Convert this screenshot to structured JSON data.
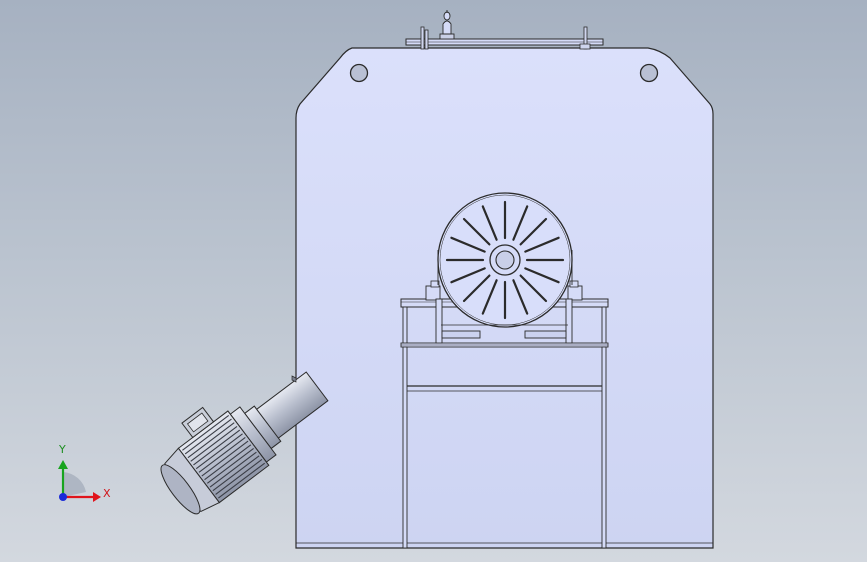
{
  "triad": {
    "x_label": "X",
    "y_label": "Y",
    "x_color": "#e0141c",
    "y_color": "#17a41e",
    "z_color": "#1a2bd8"
  },
  "colors": {
    "background_top": "#a6b1c1",
    "background_bottom": "#d3d8df",
    "body_fill": "#d5dbf7",
    "outline": "#2b2b2b",
    "motor_fill": "#c3c9d8"
  },
  "icons": [
    "view-orientation-triad-icon"
  ]
}
